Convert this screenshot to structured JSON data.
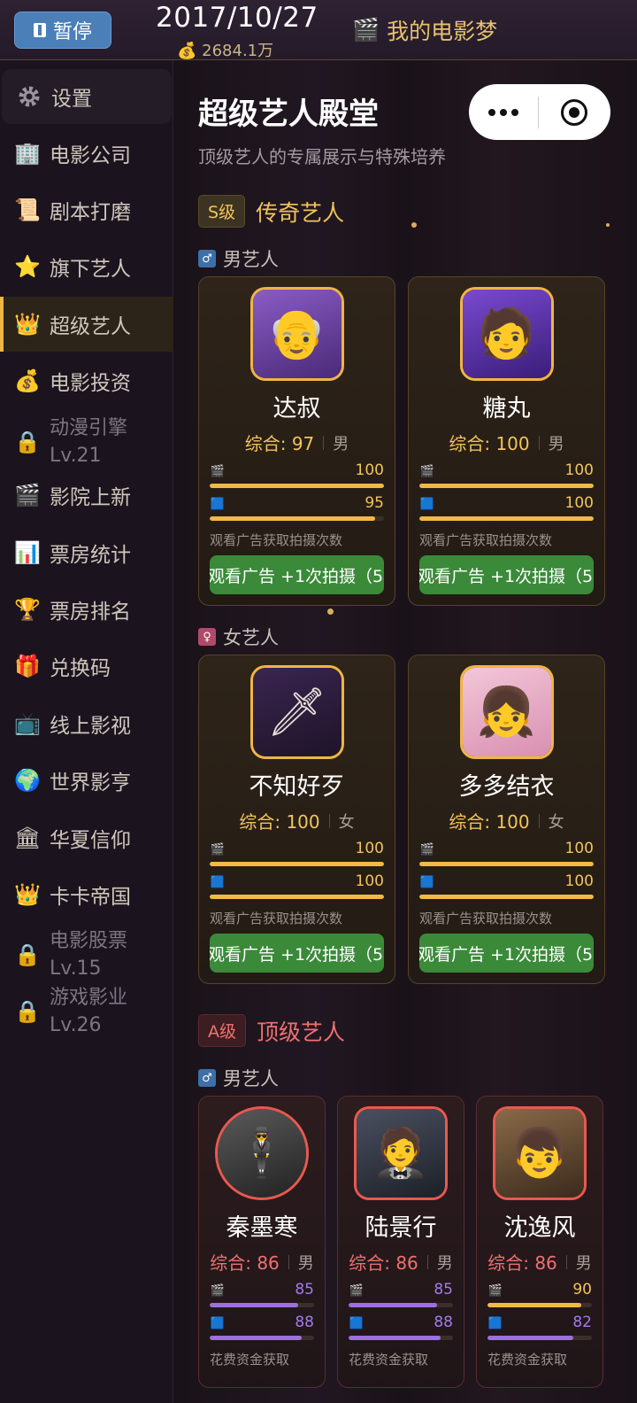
{
  "topbar": {
    "pause_label": "暂停",
    "date": "2017/10/27",
    "money": "2684.1万",
    "app_title": "我的电影梦"
  },
  "sidebar": {
    "items": [
      {
        "label": "设置",
        "icon": "gear-icon"
      },
      {
        "label": "电影公司",
        "icon": "building-icon"
      },
      {
        "label": "剧本打磨",
        "icon": "scroll-icon"
      },
      {
        "label": "旗下艺人",
        "icon": "star-icon"
      },
      {
        "label": "超级艺人",
        "icon": "crown-icon"
      },
      {
        "label": "电影投资",
        "icon": "money-bag-icon"
      },
      {
        "label": "动漫引擎",
        "sub": "Lv.21",
        "icon": "lock-icon"
      },
      {
        "label": "影院上新",
        "icon": "clapper-icon"
      },
      {
        "label": "票房统计",
        "icon": "bar-chart-icon"
      },
      {
        "label": "票房排名",
        "icon": "trophy-icon"
      },
      {
        "label": "兑换码",
        "icon": "gift-icon"
      },
      {
        "label": "线上影视",
        "icon": "tv-icon"
      },
      {
        "label": "世界影亨",
        "icon": "globe-icon"
      },
      {
        "label": "华夏信仰",
        "icon": "temple-icon"
      },
      {
        "label": "卡卡帝国",
        "icon": "crown-icon"
      },
      {
        "label": "电影股票",
        "sub": "Lv.15",
        "icon": "lock-icon"
      },
      {
        "label": "游戏影业",
        "sub": "Lv.26",
        "icon": "lock-icon"
      }
    ]
  },
  "main": {
    "title": "超级艺人殿堂",
    "subtitle": "顶级艺人的专属展示与特殊培养",
    "tiers": {
      "s": {
        "badge": "S级",
        "name": "传奇艺人"
      },
      "a": {
        "badge": "A级",
        "name": "顶级艺人"
      }
    },
    "genders": {
      "male": "男艺人",
      "female": "女艺人"
    },
    "cards": [
      {
        "name": "达叔",
        "score_label": "综合: 97",
        "gender": "男",
        "acting": "100",
        "charm": "95",
        "hint": "观看广告获取拍摄次数",
        "button": "观看广告 +1次拍摄（5"
      },
      {
        "name": "糖丸",
        "score_label": "综合: 100",
        "gender": "男",
        "acting": "100",
        "charm": "100",
        "hint": "观看广告获取拍摄次数",
        "button": "观看广告 +1次拍摄（5"
      },
      {
        "name": "不知好歹",
        "score_label": "综合: 100",
        "gender": "女",
        "acting": "100",
        "charm": "100",
        "hint": "观看广告获取拍摄次数",
        "button": "观看广告 +1次拍摄（5"
      },
      {
        "name": "多多结衣",
        "score_label": "综合: 100",
        "gender": "女",
        "acting": "100",
        "charm": "100",
        "hint": "观看广告获取拍摄次数",
        "button": "观看广告 +1次拍摄（5"
      },
      {
        "name": "秦墨寒",
        "score_label": "综合: 86",
        "gender": "男",
        "acting": "85",
        "charm": "88",
        "hint": "花费资金获取"
      },
      {
        "name": "陆景行",
        "score_label": "综合: 86",
        "gender": "男",
        "acting": "85",
        "charm": "88",
        "hint": "花费资金获取"
      },
      {
        "name": "沈逸风",
        "score_label": "综合: 86",
        "gender": "男",
        "acting": "90",
        "charm": "82",
        "hint": "花费资金获取"
      }
    ]
  },
  "colors": {
    "accent_gold": "#f2c45a",
    "accent_red": "#f07070",
    "button_green": "#3b8a3a",
    "bar_purple": "#9c70e0"
  }
}
